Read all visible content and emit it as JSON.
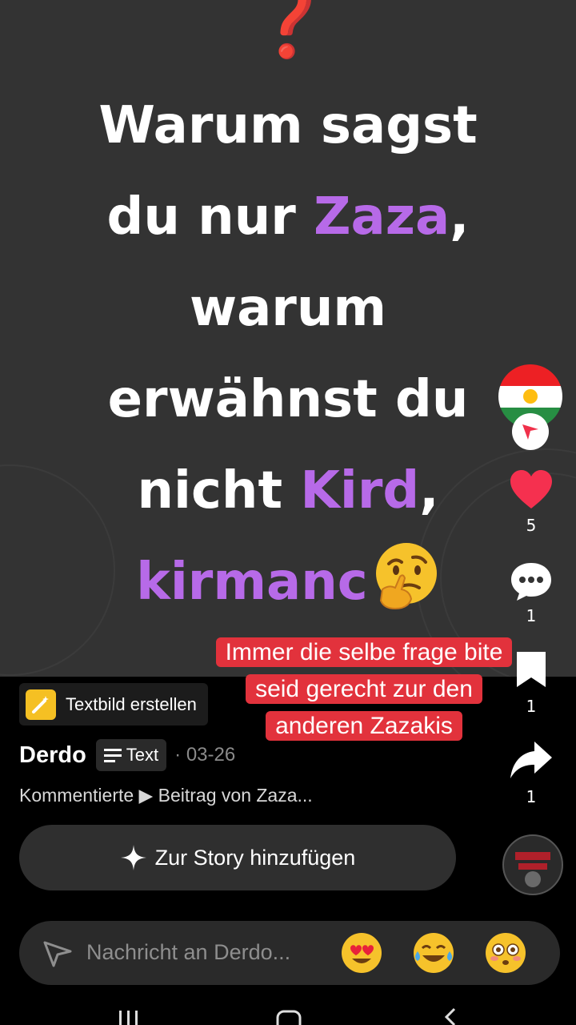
{
  "post": {
    "question_mark": "❓",
    "headline": {
      "line1": "Warum sagst",
      "line2_pre": "du nur ",
      "line2_highlight": "Zaza",
      "line2_post": ",",
      "line3": "warum",
      "line4": "erwähnst du",
      "line5_pre": "nicht ",
      "line5_highlight": "Kird",
      "line5_post": ",",
      "line6_highlight": "kirmanc",
      "line6_emoji": "thinking-face-emoji"
    },
    "highlight_color": "#b76ae8",
    "question_mark_color": "#e0212b"
  },
  "sticker": {
    "line1": "Immer die selbe frage bite",
    "line2": "seid gerecht zur den",
    "line3": "anderen Zazakis",
    "color": "#e2323c"
  },
  "actions": {
    "like_count": "5",
    "comment_count": "1",
    "save_count": "1",
    "share_count": "1",
    "like_color": "#f5304f"
  },
  "creator": {
    "chip_label": "Textbild erstellen",
    "username": "Derdo",
    "type_label": "Text",
    "date": "· 03-26",
    "commented": "Kommentierte ▶ Beitrag von Zaza..."
  },
  "story_button": {
    "label": "Zur Story hinzufügen"
  },
  "message_bar": {
    "placeholder": "Nachricht an Derdo...",
    "emojis": [
      "heart-eyes-emoji",
      "tears-of-joy-emoji",
      "flushed-face-emoji"
    ]
  }
}
